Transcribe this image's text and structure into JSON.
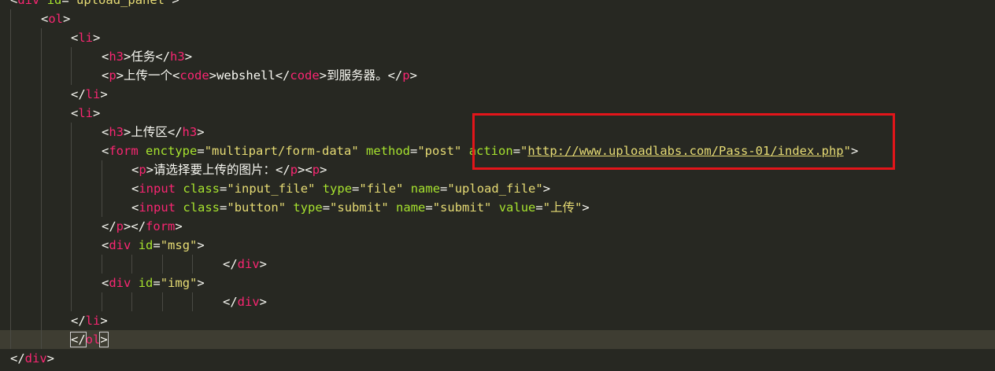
{
  "theme": {
    "background": "#272822",
    "tag": "#f92672",
    "attribute": "#a6e22e",
    "string": "#e6db74",
    "text": "#f8f8f2",
    "highlight_border": "#e3151a"
  },
  "code": {
    "lines": [
      {
        "indent": 0,
        "tokens": [
          {
            "type": "p",
            "text": "<"
          },
          {
            "type": "t",
            "text": "div"
          },
          {
            "type": "x",
            "text": " "
          },
          {
            "type": "a",
            "text": "id"
          },
          {
            "type": "p",
            "text": "="
          },
          {
            "type": "s",
            "text": "\"upload_panel\""
          },
          {
            "type": "p",
            "text": ">"
          }
        ]
      },
      {
        "indent": 1,
        "tokens": [
          {
            "type": "p",
            "text": "<"
          },
          {
            "type": "t",
            "text": "ol"
          },
          {
            "type": "p",
            "text": ">"
          }
        ]
      },
      {
        "indent": 2,
        "tokens": [
          {
            "type": "p",
            "text": "<"
          },
          {
            "type": "t",
            "text": "li"
          },
          {
            "type": "p",
            "text": ">"
          }
        ]
      },
      {
        "indent": 3,
        "tokens": [
          {
            "type": "p",
            "text": "<"
          },
          {
            "type": "t",
            "text": "h3"
          },
          {
            "type": "p",
            "text": ">"
          },
          {
            "type": "x",
            "text": "任务"
          },
          {
            "type": "p",
            "text": "</"
          },
          {
            "type": "t",
            "text": "h3"
          },
          {
            "type": "p",
            "text": ">"
          }
        ]
      },
      {
        "indent": 3,
        "tokens": [
          {
            "type": "p",
            "text": "<"
          },
          {
            "type": "t",
            "text": "p"
          },
          {
            "type": "p",
            "text": ">"
          },
          {
            "type": "x",
            "text": "上传一个"
          },
          {
            "type": "p",
            "text": "<"
          },
          {
            "type": "t",
            "text": "code"
          },
          {
            "type": "p",
            "text": ">"
          },
          {
            "type": "x",
            "text": "webshell"
          },
          {
            "type": "p",
            "text": "</"
          },
          {
            "type": "t",
            "text": "code"
          },
          {
            "type": "p",
            "text": ">"
          },
          {
            "type": "x",
            "text": "到服务器。"
          },
          {
            "type": "p",
            "text": "</"
          },
          {
            "type": "t",
            "text": "p"
          },
          {
            "type": "p",
            "text": ">"
          }
        ]
      },
      {
        "indent": 2,
        "tokens": [
          {
            "type": "p",
            "text": "</"
          },
          {
            "type": "t",
            "text": "li"
          },
          {
            "type": "p",
            "text": ">"
          }
        ]
      },
      {
        "indent": 2,
        "tokens": [
          {
            "type": "p",
            "text": "<"
          },
          {
            "type": "t",
            "text": "li"
          },
          {
            "type": "p",
            "text": ">"
          }
        ]
      },
      {
        "indent": 3,
        "tokens": [
          {
            "type": "p",
            "text": "<"
          },
          {
            "type": "t",
            "text": "h3"
          },
          {
            "type": "p",
            "text": ">"
          },
          {
            "type": "x",
            "text": "上传区"
          },
          {
            "type": "p",
            "text": "</"
          },
          {
            "type": "t",
            "text": "h3"
          },
          {
            "type": "p",
            "text": ">"
          }
        ]
      },
      {
        "indent": 3,
        "tokens": [
          {
            "type": "p",
            "text": "<"
          },
          {
            "type": "t",
            "text": "form"
          },
          {
            "type": "x",
            "text": " "
          },
          {
            "type": "a",
            "text": "enctype"
          },
          {
            "type": "p",
            "text": "="
          },
          {
            "type": "s",
            "text": "\"multipart/form-data\""
          },
          {
            "type": "x",
            "text": " "
          },
          {
            "type": "a",
            "text": "method"
          },
          {
            "type": "p",
            "text": "="
          },
          {
            "type": "s",
            "text": "\"post\""
          },
          {
            "type": "x",
            "text": " "
          },
          {
            "type": "a",
            "text": "action"
          },
          {
            "type": "p",
            "text": "="
          },
          {
            "type": "s",
            "text": "\""
          },
          {
            "type": "u",
            "text": "http://www.uploadlabs.com/Pass-01/index.php"
          },
          {
            "type": "s",
            "text": "\""
          },
          {
            "type": "p",
            "text": ">"
          }
        ]
      },
      {
        "indent": 4,
        "tokens": [
          {
            "type": "p",
            "text": "<"
          },
          {
            "type": "t",
            "text": "p"
          },
          {
            "type": "p",
            "text": ">"
          },
          {
            "type": "x",
            "text": "请选择要上传的图片："
          },
          {
            "type": "p",
            "text": "</"
          },
          {
            "type": "t",
            "text": "p"
          },
          {
            "type": "p",
            "text": ">"
          },
          {
            "type": "p",
            "text": "<"
          },
          {
            "type": "t",
            "text": "p"
          },
          {
            "type": "p",
            "text": ">"
          }
        ]
      },
      {
        "indent": 4,
        "tokens": [
          {
            "type": "p",
            "text": "<"
          },
          {
            "type": "t",
            "text": "input"
          },
          {
            "type": "x",
            "text": " "
          },
          {
            "type": "a",
            "text": "class"
          },
          {
            "type": "p",
            "text": "="
          },
          {
            "type": "s",
            "text": "\"input_file\""
          },
          {
            "type": "x",
            "text": " "
          },
          {
            "type": "a",
            "text": "type"
          },
          {
            "type": "p",
            "text": "="
          },
          {
            "type": "s",
            "text": "\"file\""
          },
          {
            "type": "x",
            "text": " "
          },
          {
            "type": "a",
            "text": "name"
          },
          {
            "type": "p",
            "text": "="
          },
          {
            "type": "s",
            "text": "\"upload_file\""
          },
          {
            "type": "p",
            "text": ">"
          }
        ]
      },
      {
        "indent": 4,
        "tokens": [
          {
            "type": "p",
            "text": "<"
          },
          {
            "type": "t",
            "text": "input"
          },
          {
            "type": "x",
            "text": " "
          },
          {
            "type": "a",
            "text": "class"
          },
          {
            "type": "p",
            "text": "="
          },
          {
            "type": "s",
            "text": "\"button\""
          },
          {
            "type": "x",
            "text": " "
          },
          {
            "type": "a",
            "text": "type"
          },
          {
            "type": "p",
            "text": "="
          },
          {
            "type": "s",
            "text": "\"submit\""
          },
          {
            "type": "x",
            "text": " "
          },
          {
            "type": "a",
            "text": "name"
          },
          {
            "type": "p",
            "text": "="
          },
          {
            "type": "s",
            "text": "\"submit\""
          },
          {
            "type": "x",
            "text": " "
          },
          {
            "type": "a",
            "text": "value"
          },
          {
            "type": "p",
            "text": "="
          },
          {
            "type": "s",
            "text": "\"上传\""
          },
          {
            "type": "p",
            "text": ">"
          }
        ]
      },
      {
        "indent": 3,
        "tokens": [
          {
            "type": "p",
            "text": "</"
          },
          {
            "type": "t",
            "text": "p"
          },
          {
            "type": "p",
            "text": ">"
          },
          {
            "type": "p",
            "text": "</"
          },
          {
            "type": "t",
            "text": "form"
          },
          {
            "type": "p",
            "text": ">"
          }
        ]
      },
      {
        "indent": 3,
        "tokens": [
          {
            "type": "p",
            "text": "<"
          },
          {
            "type": "t",
            "text": "div"
          },
          {
            "type": "x",
            "text": " "
          },
          {
            "type": "a",
            "text": "id"
          },
          {
            "type": "p",
            "text": "="
          },
          {
            "type": "s",
            "text": "\"msg\""
          },
          {
            "type": "p",
            "text": ">"
          }
        ]
      },
      {
        "indent": 7,
        "tokens": [
          {
            "type": "p",
            "text": "</"
          },
          {
            "type": "t",
            "text": "div"
          },
          {
            "type": "p",
            "text": ">"
          }
        ]
      },
      {
        "indent": 3,
        "tokens": [
          {
            "type": "p",
            "text": "<"
          },
          {
            "type": "t",
            "text": "div"
          },
          {
            "type": "x",
            "text": " "
          },
          {
            "type": "a",
            "text": "id"
          },
          {
            "type": "p",
            "text": "="
          },
          {
            "type": "s",
            "text": "\"img\""
          },
          {
            "type": "p",
            "text": ">"
          }
        ]
      },
      {
        "indent": 7,
        "tokens": [
          {
            "type": "p",
            "text": "</"
          },
          {
            "type": "t",
            "text": "div"
          },
          {
            "type": "p",
            "text": ">"
          }
        ]
      },
      {
        "indent": 2,
        "tokens": [
          {
            "type": "p",
            "text": "</"
          },
          {
            "type": "t",
            "text": "li"
          },
          {
            "type": "p",
            "text": ">"
          }
        ]
      },
      {
        "indent": 2,
        "current": true,
        "tokens": [
          {
            "type": "p",
            "text": "</",
            "match": true
          },
          {
            "type": "t",
            "text": "ol"
          },
          {
            "type": "p",
            "text": ">",
            "match": true
          }
        ]
      },
      {
        "indent": 0,
        "tokens": [
          {
            "type": "p",
            "text": "</"
          },
          {
            "type": "t",
            "text": "div"
          },
          {
            "type": "p",
            "text": ">"
          }
        ]
      }
    ]
  }
}
